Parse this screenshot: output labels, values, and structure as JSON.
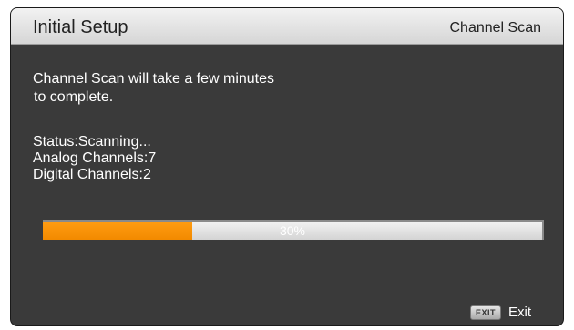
{
  "header": {
    "title": "Initial Setup",
    "section": "Channel Scan"
  },
  "message": {
    "line1": "Channel Scan will take a few minutes",
    "line2": "to complete."
  },
  "status": {
    "status_line": "Status:Scanning...",
    "analog_line": "Analog Channels:7",
    "digital_line": "Digital Channels:2"
  },
  "progress": {
    "value": 0.3,
    "label": "30%"
  },
  "footer": {
    "exit_key_label": "EXIT",
    "exit_label": "Exit"
  },
  "colors": {
    "accent": "#f28a00",
    "background": "#3a3a3a",
    "header": "#e0e0e0"
  }
}
